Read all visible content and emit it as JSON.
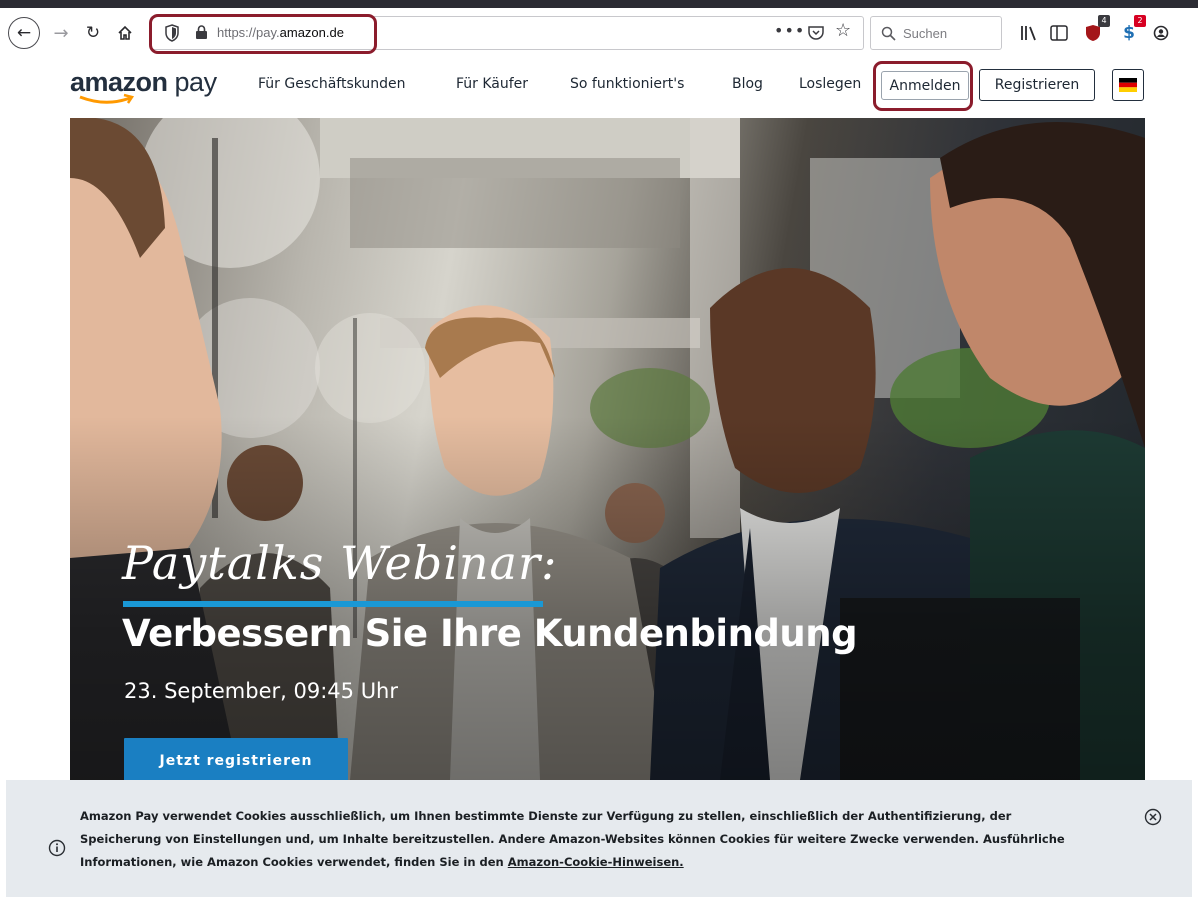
{
  "browser": {
    "url_prefix": "https://pay.",
    "url_domain": "amazon.de",
    "search_placeholder": "Suchen",
    "more_label": "•••",
    "extension_badges": [
      "4",
      "2"
    ]
  },
  "site": {
    "logo_text_1": "amazon",
    "logo_text_2": " pay",
    "nav": {
      "business": "Für Geschäftskunden",
      "buyers": "Für Käufer",
      "how": "So funktioniert's",
      "blog": "Blog",
      "start": "Loslegen"
    },
    "login_label": "Anmelden",
    "register_label": "Registrieren",
    "language_flag": "de-flag-icon"
  },
  "hero": {
    "script_title": "Paytalks Webinar:",
    "title": "Verbessern Sie Ihre Kundenbindung",
    "date": "23. September, 09:45 Uhr",
    "cta_label": "Jetzt registrieren"
  },
  "cookie": {
    "text": "Amazon Pay verwendet Cookies ausschließlich, um Ihnen bestimmte Dienste zur Verfügung zu stellen, einschließlich der Authentifizierung, der Speicherung von Einstellungen und, um Inhalte bereitzustellen. Andere Amazon-Websites können Cookies für weitere Zwecke verwenden. Ausführliche Informationen, wie Amazon Cookies verwendet, finden Sie in den ",
    "link": "Amazon-Cookie-Hinweisen."
  },
  "colors": {
    "highlight": "#8b1c2c",
    "cta": "#1a7fc2",
    "underline": "#1a98d5",
    "cookie_bg": "#e6eaee"
  }
}
